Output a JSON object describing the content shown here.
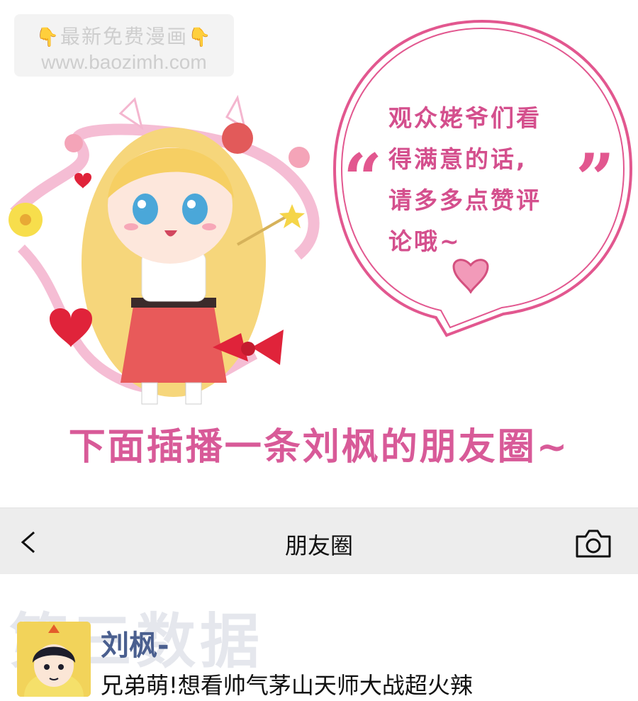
{
  "watermark": {
    "line1": "最新免费漫画",
    "line2": "www.baozimh.com",
    "hand_icon": "pointing-down-hand-icon"
  },
  "bubble": {
    "lines": [
      "观众姥爷们看",
      "得满意的话,",
      "请多多点赞评",
      "论哦~"
    ],
    "quote_open": "“",
    "quote_close": "”"
  },
  "banner": {
    "text": "下面插播一条刘枫的朋友圈~"
  },
  "moments_header": {
    "title": "朋友圈",
    "back_icon": "chevron-left-icon",
    "camera_icon": "camera-icon"
  },
  "post": {
    "watermark_text": "第三数据",
    "author": "刘枫-",
    "text": "兄弟萌!想看帅气茅山天师大战超火辣"
  },
  "colors": {
    "accent_pink": "#d85a98",
    "bubble_pink": "#e2578f",
    "author_blue": "#4a5f8f",
    "header_bg": "#ededed"
  }
}
